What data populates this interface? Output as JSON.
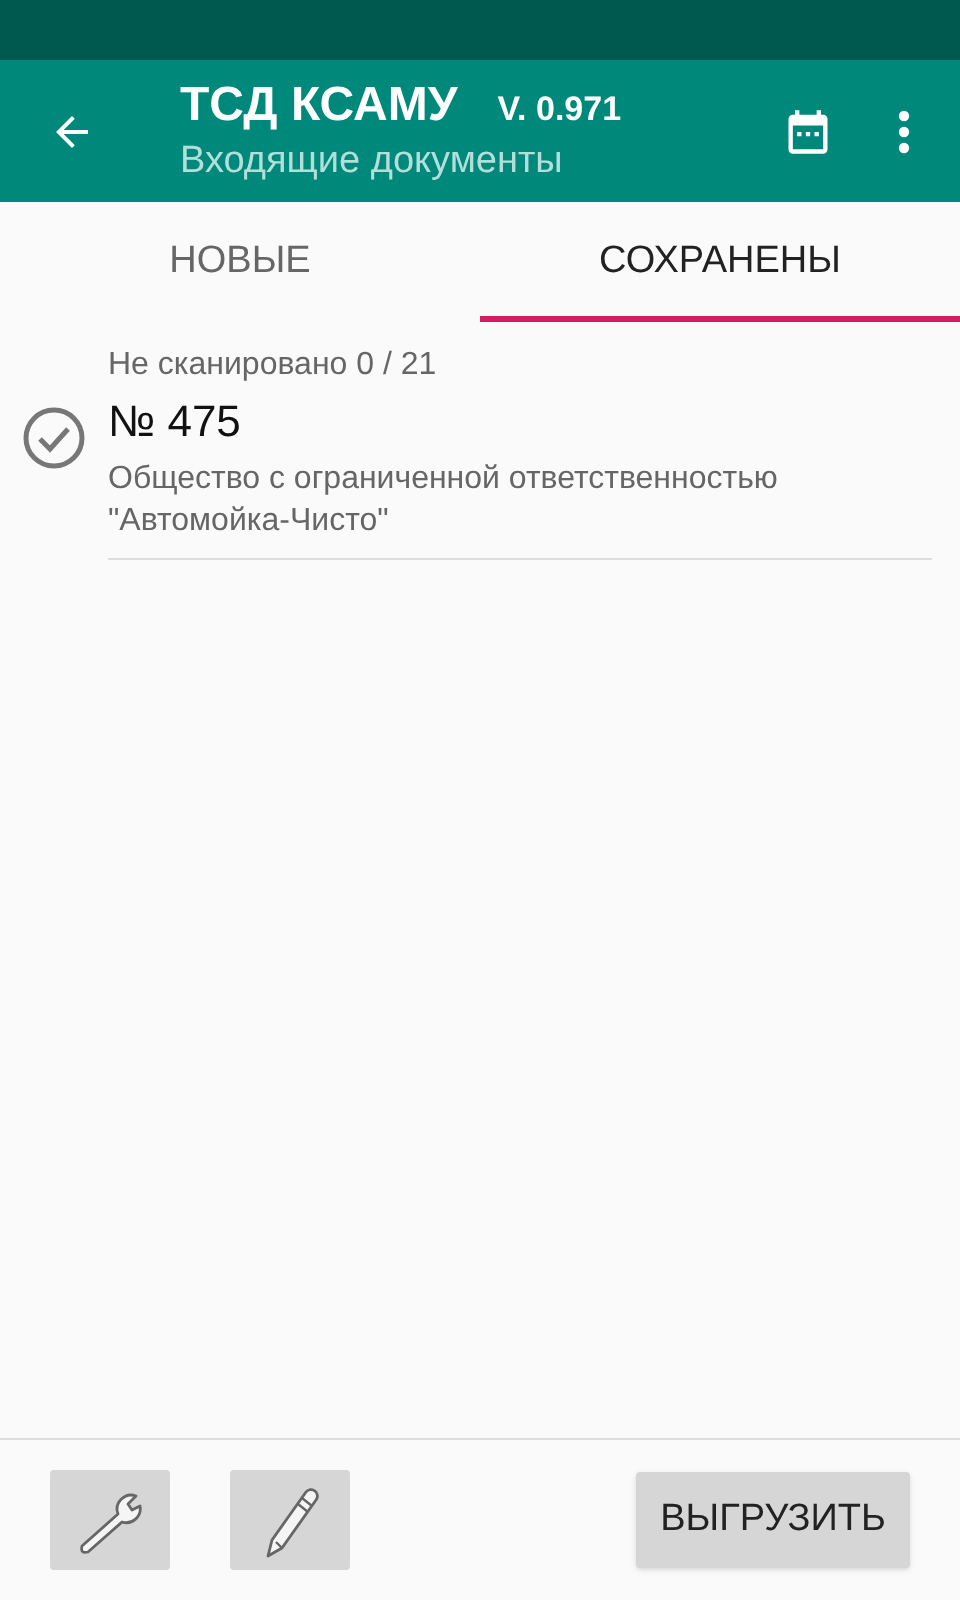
{
  "app_bar": {
    "title": "ТСД КСАМУ",
    "version": "V. 0.971",
    "subtitle": "Входящие документы"
  },
  "tabs": [
    {
      "label": "НОВЫЕ",
      "selected": false
    },
    {
      "label": "СОХРАНЕНЫ",
      "selected": true
    }
  ],
  "documents": [
    {
      "scan_status": "Не сканировано 0 / 21",
      "number": "№ 475",
      "supplier": "Общество с ограниченной ответственностью \"Автомойка-Чисто\""
    }
  ],
  "bottom_bar": {
    "upload_button": "ВЫГРУЗИТЬ"
  }
}
